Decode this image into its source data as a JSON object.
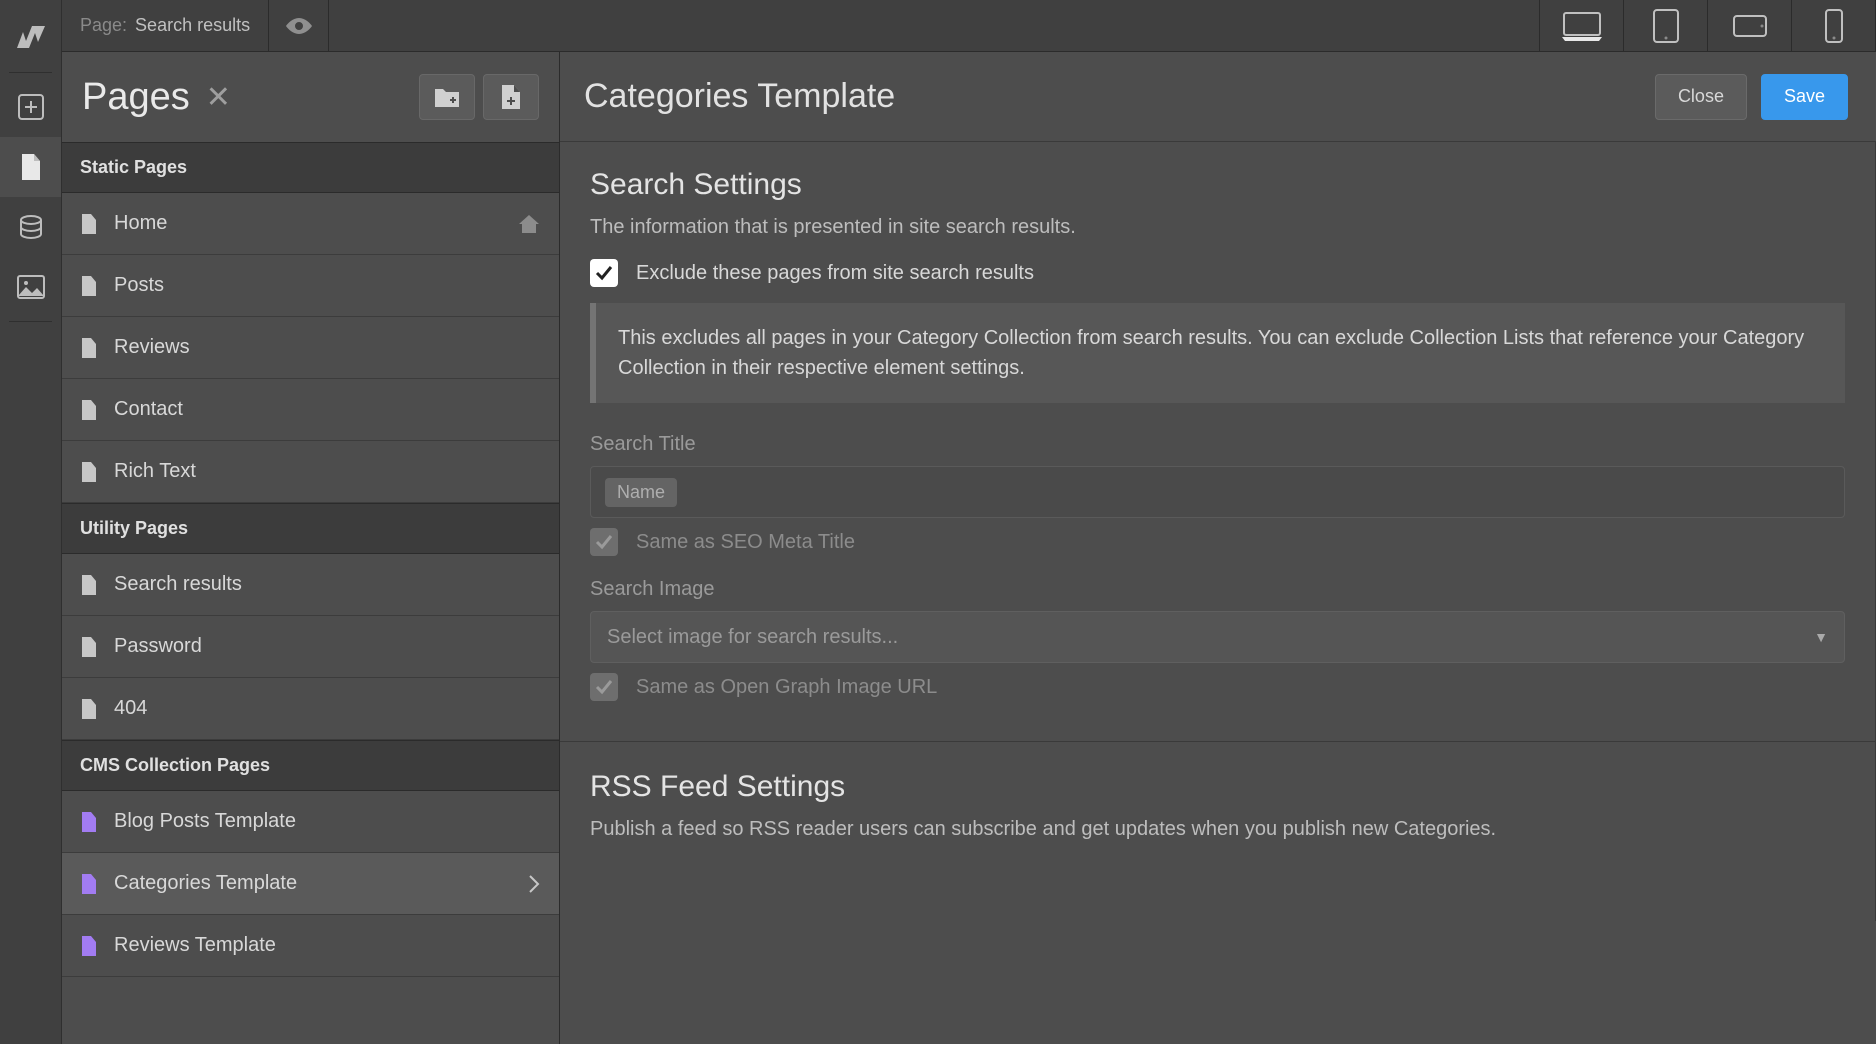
{
  "topbar": {
    "page_label": "Page:",
    "page_name": "Search results"
  },
  "pages_panel": {
    "title": "Pages",
    "sections": {
      "static": "Static Pages",
      "utility": "Utility Pages",
      "cms": "CMS Collection Pages"
    },
    "items": {
      "static": [
        {
          "label": "Home",
          "is_home": true
        },
        {
          "label": "Posts"
        },
        {
          "label": "Reviews"
        },
        {
          "label": "Contact"
        },
        {
          "label": "Rich Text"
        }
      ],
      "utility": [
        {
          "label": "Search results"
        },
        {
          "label": "Password"
        },
        {
          "label": "404"
        }
      ],
      "cms": [
        {
          "label": "Blog Posts Template"
        },
        {
          "label": "Categories Template",
          "active": true
        },
        {
          "label": "Reviews Template"
        }
      ]
    }
  },
  "settings": {
    "title": "Categories Template",
    "close_label": "Close",
    "save_label": "Save",
    "search": {
      "heading": "Search Settings",
      "description": "The information that is presented in site search results.",
      "exclude_label": "Exclude these pages from site search results",
      "exclude_checked": true,
      "callout": "This excludes all pages in your Category Collection from search results. You can exclude Collection Lists that reference your Category Collection in their respective element settings.",
      "title_label": "Search Title",
      "title_token": "Name",
      "same_meta_label": "Same as SEO Meta Title",
      "same_meta_checked": true,
      "image_label": "Search Image",
      "image_placeholder": "Select image for search results...",
      "same_og_label": "Same as Open Graph Image URL",
      "same_og_checked": true
    },
    "rss": {
      "heading": "RSS Feed Settings",
      "description": "Publish a feed so RSS reader users can subscribe and get updates when you publish new Categories."
    }
  }
}
